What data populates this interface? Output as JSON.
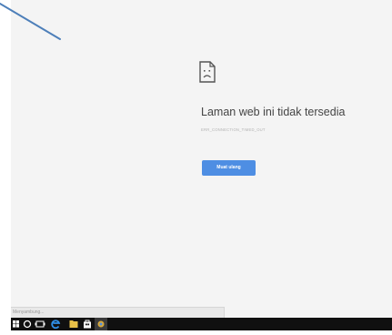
{
  "error": {
    "title": "Laman web ini tidak tersedia",
    "code": "ERR_CONNECTION_TIMED_OUT",
    "reload_label": "Muat ulang"
  },
  "status_bar": {
    "text": "Menyambung..."
  },
  "colors": {
    "page_bg": "#f4f4f4",
    "button": "#4e8ee3",
    "taskbar": "#101010",
    "stroke": "#4d7fb9"
  },
  "taskbar": {
    "icons": [
      "windows-start-icon",
      "search-icon",
      "task-view-icon",
      "edge-browser-icon",
      "file-explorer-icon",
      "store-icon",
      "chrome-icon"
    ]
  }
}
